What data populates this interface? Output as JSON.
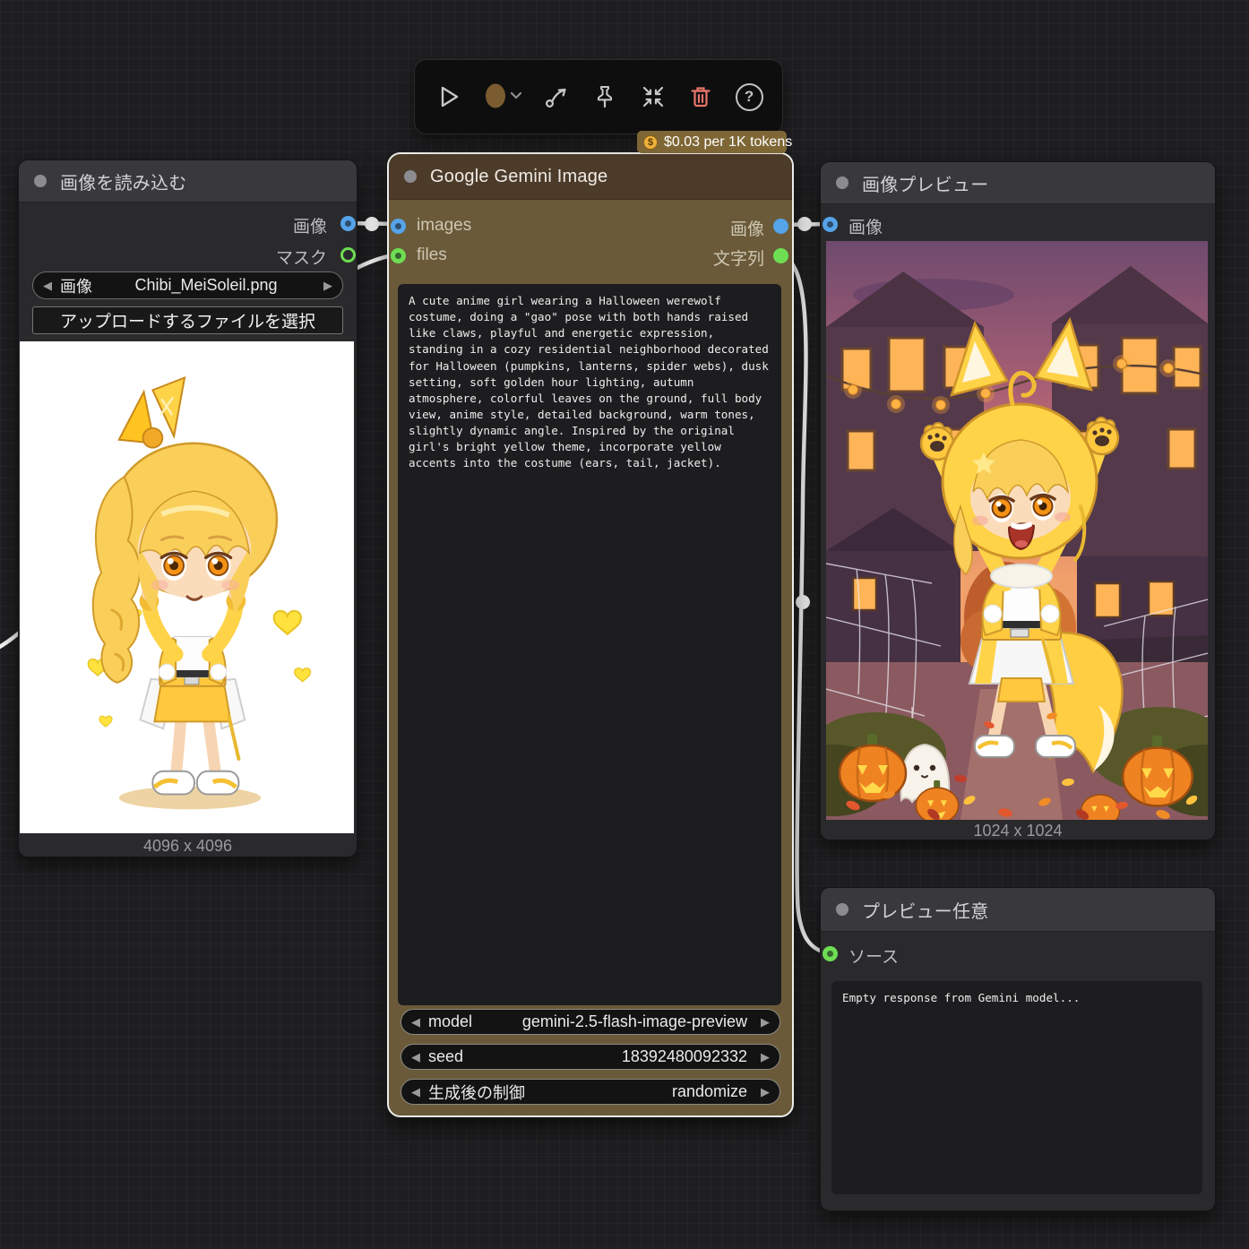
{
  "toolbar": {
    "help_glyph": "?",
    "badge": {
      "coin_glyph": "$",
      "label": "$0.03 per 1K tokens"
    }
  },
  "icons": {
    "arrow_left": "◀",
    "arrow_right": "▶"
  },
  "nodes": {
    "load_image": {
      "title": "画像を読み込む",
      "outputs": [
        {
          "label": "画像"
        },
        {
          "label": "マスク"
        }
      ],
      "image_widget": {
        "label": "画像",
        "value": "Chibi_MeiSoleil.png"
      },
      "upload_button_label": "アップロードするファイルを選択",
      "resolution": "4096 x 4096",
      "preview_description": "Chibi anime girl, blonde side ponytail with yellow ribbon, orange eyes, hands on cheeks, yellow cropped jacket, white and yellow skirt, yellow hearts, white background"
    },
    "gemini": {
      "title": "Google Gemini Image",
      "inputs": [
        {
          "label": "images"
        },
        {
          "label": "files"
        }
      ],
      "outputs": [
        {
          "label": "画像"
        },
        {
          "label": "文字列"
        }
      ],
      "prompt": "A cute anime girl wearing a Halloween werewolf costume, doing a \"gao\" pose with both hands raised like claws, playful and energetic expression, standing in a cozy residential neighborhood decorated for Halloween (pumpkins, lanterns, spider webs), dusk setting, soft golden hour lighting, autumn atmosphere, colorful leaves on the ground, full body view, anime style, detailed background, warm tones, slightly dynamic angle. Inspired by the original girl's bright yellow theme, incorporate yellow accents into the costume (ears, tail, jacket).",
      "widgets": [
        {
          "label": "model",
          "value": "gemini-2.5-flash-image-preview"
        },
        {
          "label": "seed",
          "value": "18392480092332"
        },
        {
          "label": "生成後の制御",
          "value": "randomize"
        }
      ]
    },
    "image_preview": {
      "title": "画像プレビュー",
      "inputs": [
        {
          "label": "画像"
        }
      ],
      "resolution": "1024 x 1024",
      "preview_description": "Chibi anime girl in yellow fox-ear werewolf hood doing gao pose, Halloween neighborhood at dusk, pumpkins, ghost, spider webs, autumn leaves"
    },
    "preview_any": {
      "title": "プレビュー任意",
      "inputs": [
        {
          "label": "ソース"
        }
      ],
      "text": "Empty response from Gemini model..."
    }
  },
  "colors": {
    "port_image": "#55a3e8",
    "port_mask": "#6ede52",
    "port_string": "#6ede52",
    "wire": "#f4f4f4",
    "gemini_header": "#4d3b2a",
    "gemini_body": "#6a5a39",
    "selected_border": "#ececea",
    "trash_red": "#e8756a",
    "coin_gold": "#eeb13a",
    "badge_bg": "#7e6735"
  }
}
